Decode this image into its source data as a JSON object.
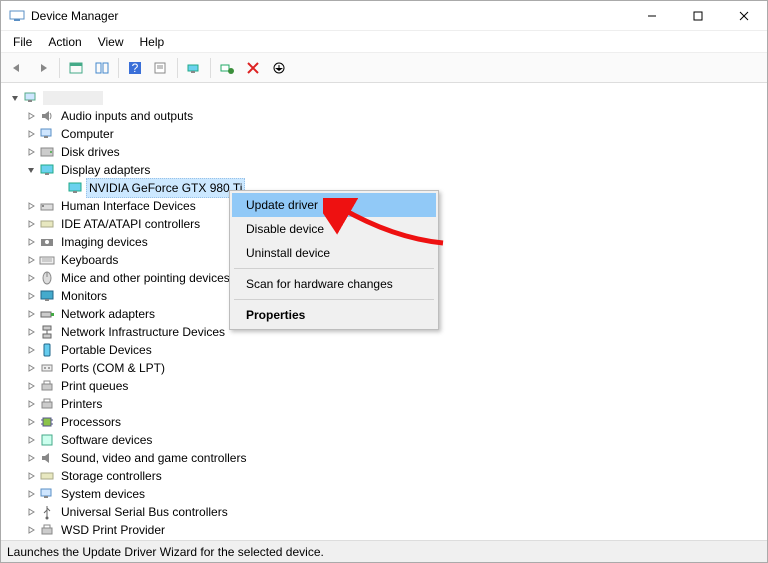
{
  "window": {
    "title": "Device Manager"
  },
  "menu": {
    "file": "File",
    "action": "Action",
    "view": "View",
    "help": "Help"
  },
  "tree": {
    "root": "",
    "display_adapters": "Display adapters",
    "selected_device": "NVIDIA GeForce GTX 980 Ti",
    "items": [
      "Audio inputs and outputs",
      "Computer",
      "Disk drives",
      "Human Interface Devices",
      "IDE ATA/ATAPI controllers",
      "Imaging devices",
      "Keyboards",
      "Mice and other pointing devices",
      "Monitors",
      "Network adapters",
      "Network Infrastructure Devices",
      "Portable Devices",
      "Ports (COM & LPT)",
      "Print queues",
      "Printers",
      "Processors",
      "Software devices",
      "Sound, video and game controllers",
      "Storage controllers",
      "System devices",
      "Universal Serial Bus controllers",
      "WSD Print Provider"
    ]
  },
  "context_menu": {
    "update": "Update driver",
    "disable": "Disable device",
    "uninstall": "Uninstall device",
    "scan": "Scan for hardware changes",
    "properties": "Properties"
  },
  "status": "Launches the Update Driver Wizard for the selected device."
}
